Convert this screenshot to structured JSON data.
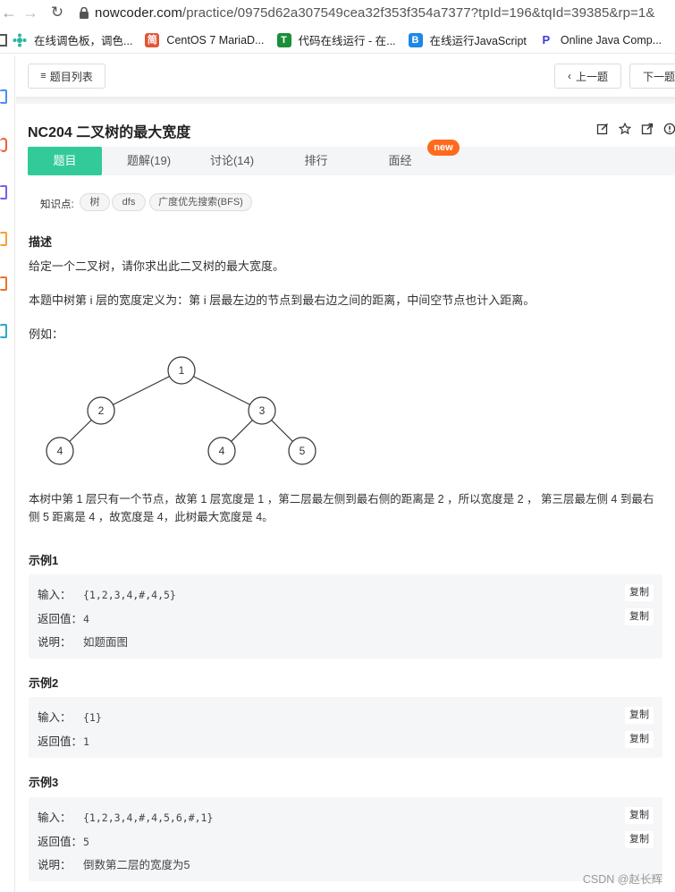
{
  "browser": {
    "url_host": "nowcoder.com",
    "url_path": "/practice/0975d62a307549cea32f353f354a7377?tpId=196&tqId=39385&rp=1&"
  },
  "bookmarks": [
    {
      "label": "在线调色板，调色...",
      "color": "#2bb5a0"
    },
    {
      "label": "CentOS 7 MariaD...",
      "color": "#e2553b",
      "glyph": "简"
    },
    {
      "label": "代码在线运行 - 在...",
      "color": "#1a8f3a",
      "glyph": "T"
    },
    {
      "label": "在线运行JavaScript",
      "color": "#1e88e5",
      "glyph": "B"
    },
    {
      "label": "Online Java Comp...",
      "color": "#3b3bd6",
      "glyph": "P"
    }
  ],
  "toolbar": {
    "list_label": "题目列表",
    "prev_label": "上一题",
    "next_label": "下一题"
  },
  "problem": {
    "title": "NC204  二叉树的最大宽度"
  },
  "tabs": [
    {
      "label": "题目",
      "active": true
    },
    {
      "label": "题解(19)"
    },
    {
      "label": "讨论(14)"
    },
    {
      "label": "排行"
    },
    {
      "label": "面经"
    }
  ],
  "new_badge": "new",
  "knowledge": {
    "label": "知识点:",
    "tags": [
      "树",
      "dfs",
      "广度优先搜索(BFS)"
    ]
  },
  "description": {
    "heading": "描述",
    "line1": "给定一个二叉树，请你求出此二叉树的最大宽度。",
    "line2": "本题中树第 i 层的宽度定义为：第 i 层最左边的节点到最右边之间的距离，中间空节点也计入距离。",
    "example_intro": "例如：",
    "tree_nodes": [
      "1",
      "2",
      "3",
      "4",
      "4",
      "5"
    ],
    "explain_line1": "本树中第 1 层只有一个节点，故第 1 层宽度是 1 ，第二层最左侧到最右侧的距离是 2 ，所以宽度是 2 ， 第三层最左侧 4 到最右",
    "explain_line2": "侧 5 距离是 4 ，故宽度是 4，此树最大宽度是 4。"
  },
  "examples": [
    {
      "heading": "示例1",
      "input_label": "输入：",
      "input": "{1,2,3,4,#,4,5}",
      "return_label": "返回值：",
      "return": "4",
      "note_label": "说明：",
      "note": "如题面图",
      "copy": "复制"
    },
    {
      "heading": "示例2",
      "input_label": "输入：",
      "input": "{1}",
      "return_label": "返回值：",
      "return": "1",
      "copy": "复制"
    },
    {
      "heading": "示例3",
      "input_label": "输入：",
      "input": "{1,2,3,4,#,4,5,6,#,1}",
      "return_label": "返回值：",
      "return": "5",
      "note_label": "说明：",
      "note": "倒数第二层的宽度为5",
      "copy": "复制"
    }
  ],
  "watermark": "CSDN @赵长辉",
  "colors": {
    "accent": "#32ca99",
    "badge": "#ff6a1f"
  }
}
